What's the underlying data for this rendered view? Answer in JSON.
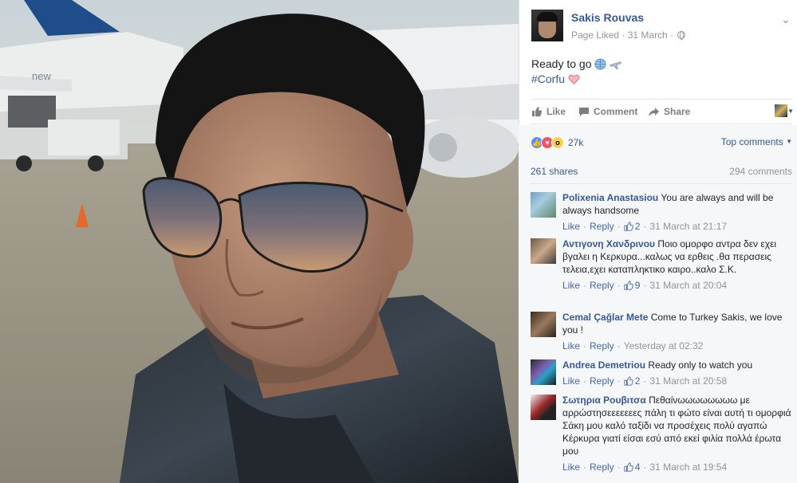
{
  "post": {
    "page_name": "Sakis Rouvas",
    "meta": "Page Liked · 31 March ·",
    "text_line1": "Ready to go",
    "hashtag": "#Corfu",
    "actions": {
      "like": "Like",
      "comment": "Comment",
      "share": "Share"
    }
  },
  "feedback": {
    "reaction_count": "27k",
    "top_comments": "Top comments",
    "shares": "261 shares",
    "comments": "294 comments"
  },
  "comments": [
    {
      "author": "Polixenia Anastasiou",
      "text": "You are always and will be always handsome",
      "like": "Like",
      "reply": "Reply",
      "likes": "2",
      "time": "31 March at 21:17"
    },
    {
      "author": "Αντιγονη Χανδρινου",
      "text": "Ποιο ομορφο αντρα δεν εχει βγαλει η Κερκυρα...καλως να ερθεις .θα περασεις τελεια,εχει καταπληκτικο καιρο..καλο Σ.Κ.",
      "like": "Like",
      "reply": "Reply",
      "likes": "9",
      "time": "31 March at 20:04"
    },
    {
      "author": "Cemal Çağlar Mete",
      "text": "Come to Turkey Sakis, we love you !",
      "like": "Like",
      "reply": "Reply",
      "likes": "",
      "time": "Yesterday at 02:32"
    },
    {
      "author": "Andrea Demetriou",
      "text": "Ready only to watch you",
      "like": "Like",
      "reply": "Reply",
      "likes": "2",
      "time": "31 March at 20:58"
    },
    {
      "author": "Σωτηρια Ρουβιτσα",
      "text": "Πεθαίνωωωωωωωω με αρρώστησεεεεεεες πάλη τι φώτο είναι αυτή τι ομορφιά Σάκη μου καλό ταξίδι να προσέχεις πολύ αγαπώ Κέρκυρα γιατί είσαι εσύ από εκεί φιλία πολλά έρωτα μου",
      "like": "Like",
      "reply": "Reply",
      "likes": "4",
      "time": "31 March at 19:54"
    }
  ],
  "colors": {
    "link": "#365899",
    "meta": "#90949c",
    "bg_feedback": "#f6f7f9"
  }
}
